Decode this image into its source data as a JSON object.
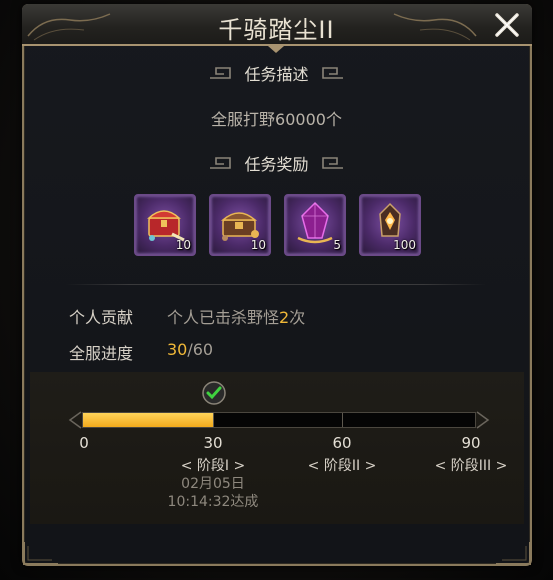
{
  "window": {
    "title": "千骑踏尘II"
  },
  "task_desc": {
    "header": "任务描述",
    "text": "全服打野60000个"
  },
  "task_rewards": {
    "header": "任务奖励",
    "items": [
      {
        "icon": "treasure-chest-icon",
        "count": "10"
      },
      {
        "icon": "gold-chest-icon",
        "count": "10"
      },
      {
        "icon": "purple-gem-icon",
        "count": "5"
      },
      {
        "icon": "amber-crystal-icon",
        "count": "100"
      }
    ]
  },
  "personal": {
    "label": "个人贡献",
    "text_prefix": "个人已击杀野怪",
    "kills": "2",
    "text_suffix": "次"
  },
  "server": {
    "label": "全服进度",
    "current": "30",
    "total": "/60"
  },
  "progress": {
    "fraction": 0.333,
    "ticks": [
      "0",
      "30",
      "60",
      "90"
    ],
    "stages": [
      {
        "left": "<",
        "name": "阶段I",
        "right": ">"
      },
      {
        "left": "<",
        "name": "阶段II",
        "right": ">"
      },
      {
        "left": "<",
        "name": "阶段III",
        "right": ">"
      }
    ],
    "achieved_date": "02月05日",
    "achieved_time": "10:14:32达成"
  },
  "colors": {
    "accent_gold": "#f0b838",
    "frame_gold": "#a89370",
    "reward_purple": "#6b4a88"
  }
}
